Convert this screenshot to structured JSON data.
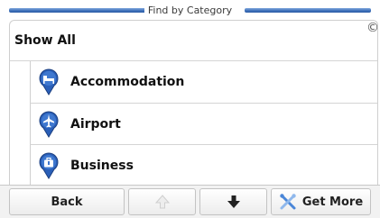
{
  "header": {
    "title": "Find by Category"
  },
  "list": {
    "show_all_label": "Show All",
    "close_glyph": "©",
    "items": [
      {
        "label": "Accommodation",
        "icon": "bed-icon"
      },
      {
        "label": "Airport",
        "icon": "airplane-icon"
      },
      {
        "label": "Business",
        "icon": "briefcase-icon"
      }
    ]
  },
  "toolbar": {
    "back_label": "Back",
    "up_icon": "arrow-up-icon",
    "down_icon": "arrow-down-icon",
    "more_label": "Get More",
    "more_icon": "tools-icon"
  },
  "colors": {
    "header_line": "#3d6fb9",
    "pin_blue": "#2a5fb8",
    "disabled_arrow": "#d0d0d0",
    "active_arrow": "#222222"
  }
}
